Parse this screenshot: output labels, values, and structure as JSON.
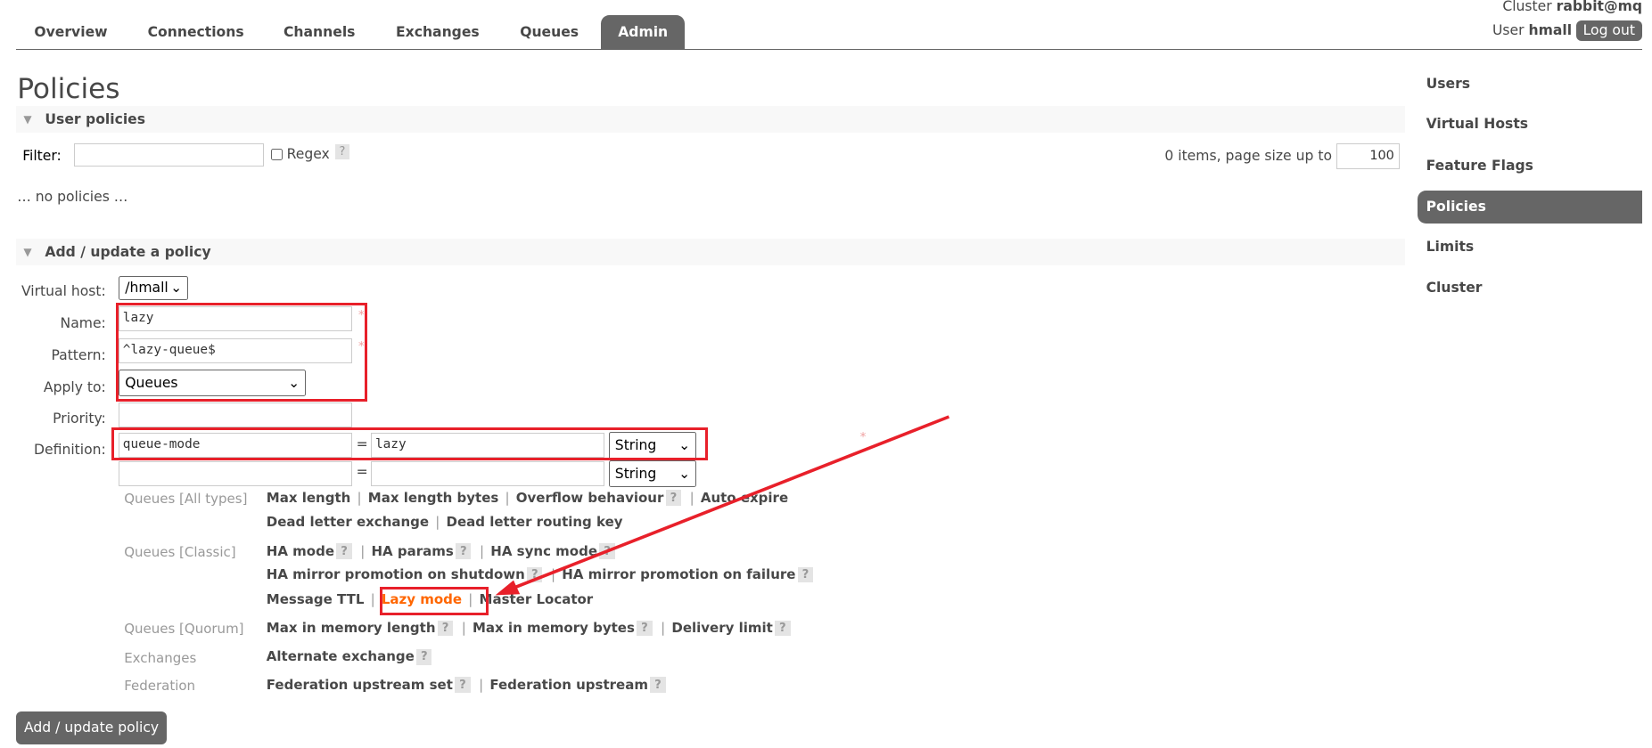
{
  "tabs": [
    "Overview",
    "Connections",
    "Channels",
    "Exchanges",
    "Queues",
    "Admin"
  ],
  "header": {
    "cluster_label": "Cluster",
    "cluster": "rabbit@mq",
    "user_label": "User",
    "user": "hmall",
    "logout": "Log out"
  },
  "page_title": "Policies",
  "user_policies": {
    "title": "User policies",
    "filter_label": "Filter:",
    "filter_value": "",
    "regex_label": "Regex",
    "help": "?",
    "items_text": "0 items, page size up to",
    "page_size": "100",
    "empty": "… no policies …"
  },
  "form": {
    "title": "Add / update a policy",
    "vhost_label": "Virtual host:",
    "vhost": "/hmall",
    "name_label": "Name:",
    "name": "lazy",
    "pattern_label": "Pattern:",
    "pattern": "^lazy-queue$",
    "apply_label": "Apply to:",
    "apply": "Queues",
    "priority_label": "Priority:",
    "priority": "",
    "definition_label": "Definition:",
    "def_key": "queue-mode",
    "def_value": "lazy",
    "def_type": "String",
    "def_key2": "",
    "def_value2": "",
    "def_type2": "String",
    "eq": "=",
    "required": "*",
    "submit": "Add / update policy"
  },
  "help_groups": [
    {
      "category": "Queues [All types]",
      "rows": [
        [
          "Max length",
          "Max length bytes",
          "Overflow behaviour ?",
          "Auto expire"
        ],
        [
          "Dead letter exchange",
          "Dead letter routing key"
        ]
      ]
    },
    {
      "category": "Queues [Classic]",
      "rows": [
        [
          "HA mode ?",
          "HA params ?",
          "HA sync mode ?"
        ],
        [
          "HA mirror promotion on shutdown ?",
          "HA mirror promotion on failure ?"
        ],
        [
          "Message TTL",
          "Lazy mode",
          "Master Locator"
        ]
      ]
    },
    {
      "category": "Queues [Quorum]",
      "rows": [
        [
          "Max in memory length ?",
          "Max in memory bytes ?",
          "Delivery limit ?"
        ]
      ]
    },
    {
      "category": "Exchanges",
      "rows": [
        [
          "Alternate exchange ?"
        ]
      ]
    },
    {
      "category": "Federation",
      "rows": [
        [
          "Federation upstream set ?",
          "Federation upstream ?"
        ]
      ]
    }
  ],
  "highlight_item": "Lazy mode",
  "highlight_color": "#ff6600",
  "annotation_color": "#e8202a",
  "sidebar": [
    "Users",
    "Virtual Hosts",
    "Feature Flags",
    "Policies",
    "Limits",
    "Cluster"
  ],
  "sidebar_active": "Policies"
}
